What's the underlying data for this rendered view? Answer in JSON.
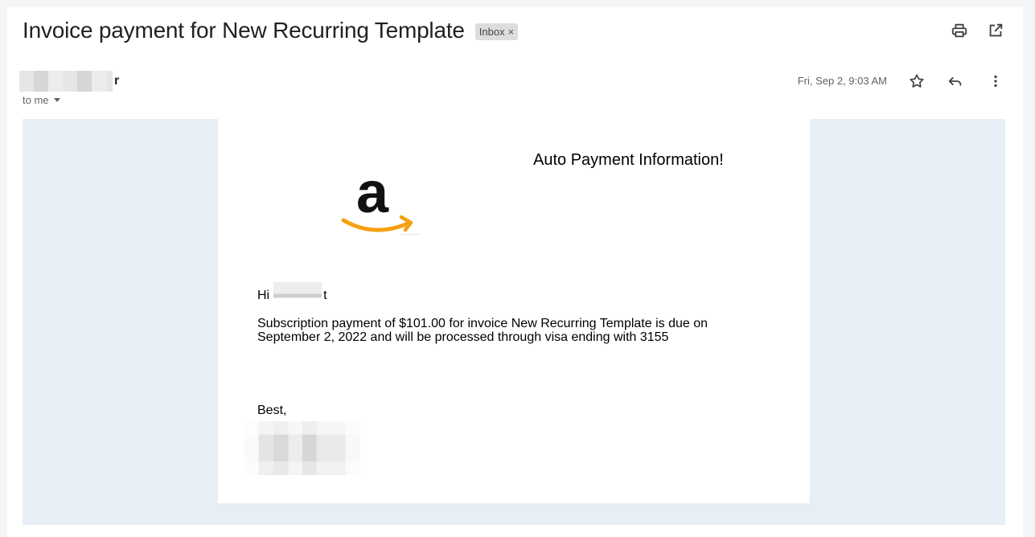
{
  "email": {
    "subject": "Invoice payment for New Recurring Template",
    "label": "Inbox",
    "label_remove": "×",
    "sender_suffix": "r",
    "recipient": "to me",
    "date": "Fri, Sep 2, 9:03 AM"
  },
  "icons": {
    "print": "printer-icon",
    "popout": "open-in-new-window-icon",
    "star": "star-icon",
    "reply": "reply-icon",
    "more": "more-vertical-icon",
    "caret": "chevron-down-icon"
  },
  "message": {
    "brand_logo": "amazon-logo",
    "title": "Auto Payment Information!",
    "greeting_prefix": "Hi",
    "greeting_suffix": "t",
    "body": "Subscription payment of $101.00 for invoice New Recurring Template is due on September 2, 2022 and will be processed through visa ending with 3155",
    "signoff": "Best,"
  },
  "colors": {
    "background_panel": "#e8eef5",
    "amazon_orange": "#f5a00f",
    "text": "#202124",
    "muted": "#5f6368"
  }
}
